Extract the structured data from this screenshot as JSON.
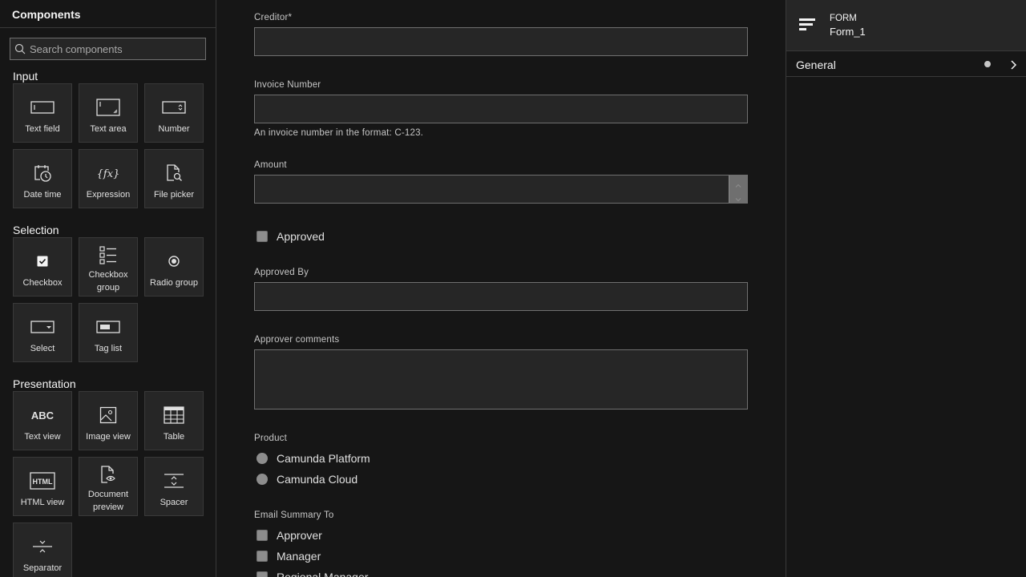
{
  "palette": {
    "title": "Components",
    "search_placeholder": "Search components",
    "groups": {
      "input": {
        "title": "Input",
        "items": [
          {
            "label": "Text field",
            "icon": "text-field-icon"
          },
          {
            "label": "Text area",
            "icon": "text-area-icon"
          },
          {
            "label": "Number",
            "icon": "number-icon"
          },
          {
            "label": "Date time",
            "icon": "date-time-icon"
          },
          {
            "label": "Expression",
            "icon": "expression-icon"
          },
          {
            "label": "File picker",
            "icon": "file-picker-icon"
          }
        ]
      },
      "selection": {
        "title": "Selection",
        "items": [
          {
            "label": "Checkbox",
            "icon": "checkbox-icon"
          },
          {
            "label": "Checkbox group",
            "icon": "checkbox-group-icon"
          },
          {
            "label": "Radio group",
            "icon": "radio-group-icon"
          },
          {
            "label": "Select",
            "icon": "select-icon"
          },
          {
            "label": "Tag list",
            "icon": "tag-list-icon"
          }
        ]
      },
      "presentation": {
        "title": "Presentation",
        "items": [
          {
            "label": "Text view",
            "icon": "text-view-icon"
          },
          {
            "label": "Image view",
            "icon": "image-view-icon"
          },
          {
            "label": "Table",
            "icon": "table-icon"
          },
          {
            "label": "HTML view",
            "icon": "html-view-icon"
          },
          {
            "label": "Document preview",
            "icon": "document-preview-icon"
          },
          {
            "label": "Spacer",
            "icon": "spacer-icon"
          },
          {
            "label": "Separator",
            "icon": "separator-icon"
          }
        ]
      }
    }
  },
  "form": {
    "creditor": {
      "label": "Creditor*",
      "value": ""
    },
    "invoice_number": {
      "label": "Invoice Number",
      "value": "",
      "description": "An invoice number in the format: C-123."
    },
    "amount": {
      "label": "Amount",
      "value": ""
    },
    "approved": {
      "label": "Approved",
      "checked": false
    },
    "approved_by": {
      "label": "Approved By",
      "value": ""
    },
    "approver_comments": {
      "label": "Approver comments",
      "value": ""
    },
    "product": {
      "label": "Product",
      "options": [
        "Camunda Platform",
        "Camunda Cloud"
      ]
    },
    "email_summary": {
      "label": "Email Summary To",
      "options": [
        "Approver",
        "Manager",
        "Regional Manager"
      ]
    }
  },
  "properties": {
    "type": "FORM",
    "name": "Form_1",
    "groups": [
      {
        "label": "General"
      }
    ]
  },
  "colors": {
    "background": "#161616",
    "panel": "#262626",
    "border": "#393939",
    "text": "#e0e0e0"
  }
}
